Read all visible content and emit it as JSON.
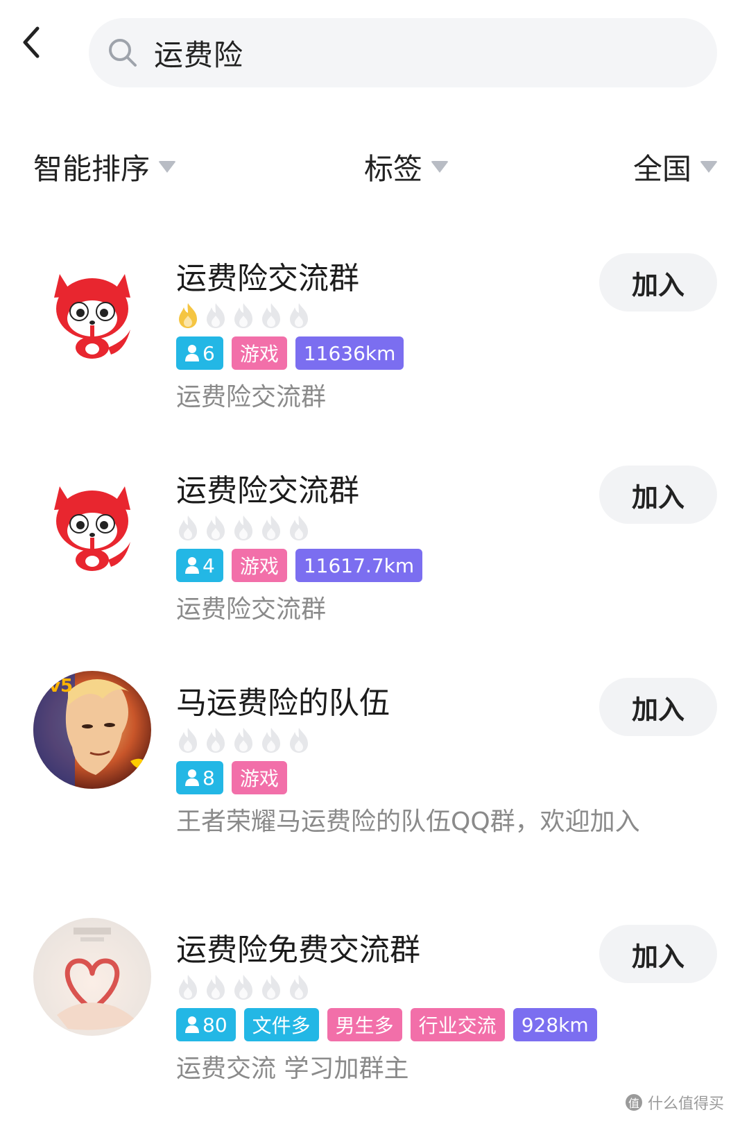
{
  "search": {
    "query": "运费险"
  },
  "filters": {
    "sort_label": "智能排序",
    "tags_label": "标签",
    "region_label": "全国"
  },
  "results": [
    {
      "title": "运费险交流群",
      "heat_level": 1,
      "heat_max": 5,
      "member_count": "6",
      "tags": [
        "游戏",
        "11636km"
      ],
      "description": "运费险交流群",
      "join_label": "加入",
      "avatar_icon": "red-fox-icon"
    },
    {
      "title": "运费险交流群",
      "heat_level": 0,
      "heat_max": 5,
      "member_count": "4",
      "tags": [
        "游戏",
        "11617.7km"
      ],
      "description": "运费险交流群",
      "join_label": "加入",
      "avatar_icon": "red-fox-icon"
    },
    {
      "title": "马运费险的队伍",
      "heat_level": 0,
      "heat_max": 5,
      "member_count": "8",
      "tags": [
        "游戏"
      ],
      "description": "王者荣耀马运费险的队伍QQ群，欢迎加入",
      "join_label": "加入",
      "avatar_icon": "game-hero-icon"
    },
    {
      "title": "运费险免费交流群",
      "heat_level": 0,
      "heat_max": 5,
      "member_count": "80",
      "tags": [
        "文件多",
        "男生多",
        "行业交流",
        "928km"
      ],
      "description": "运费交流 学习加群主",
      "join_label": "加入",
      "avatar_icon": "heart-hands-icon"
    }
  ],
  "watermark": {
    "logo_char": "值",
    "text": "什么值得买"
  },
  "colors": {
    "tag_count": "#23b7e5",
    "tag_pink": "#f26fa9",
    "tag_distance": "#7b6ef0",
    "flame_active": "#f5c542",
    "flame_inactive": "#e6e7ea"
  }
}
